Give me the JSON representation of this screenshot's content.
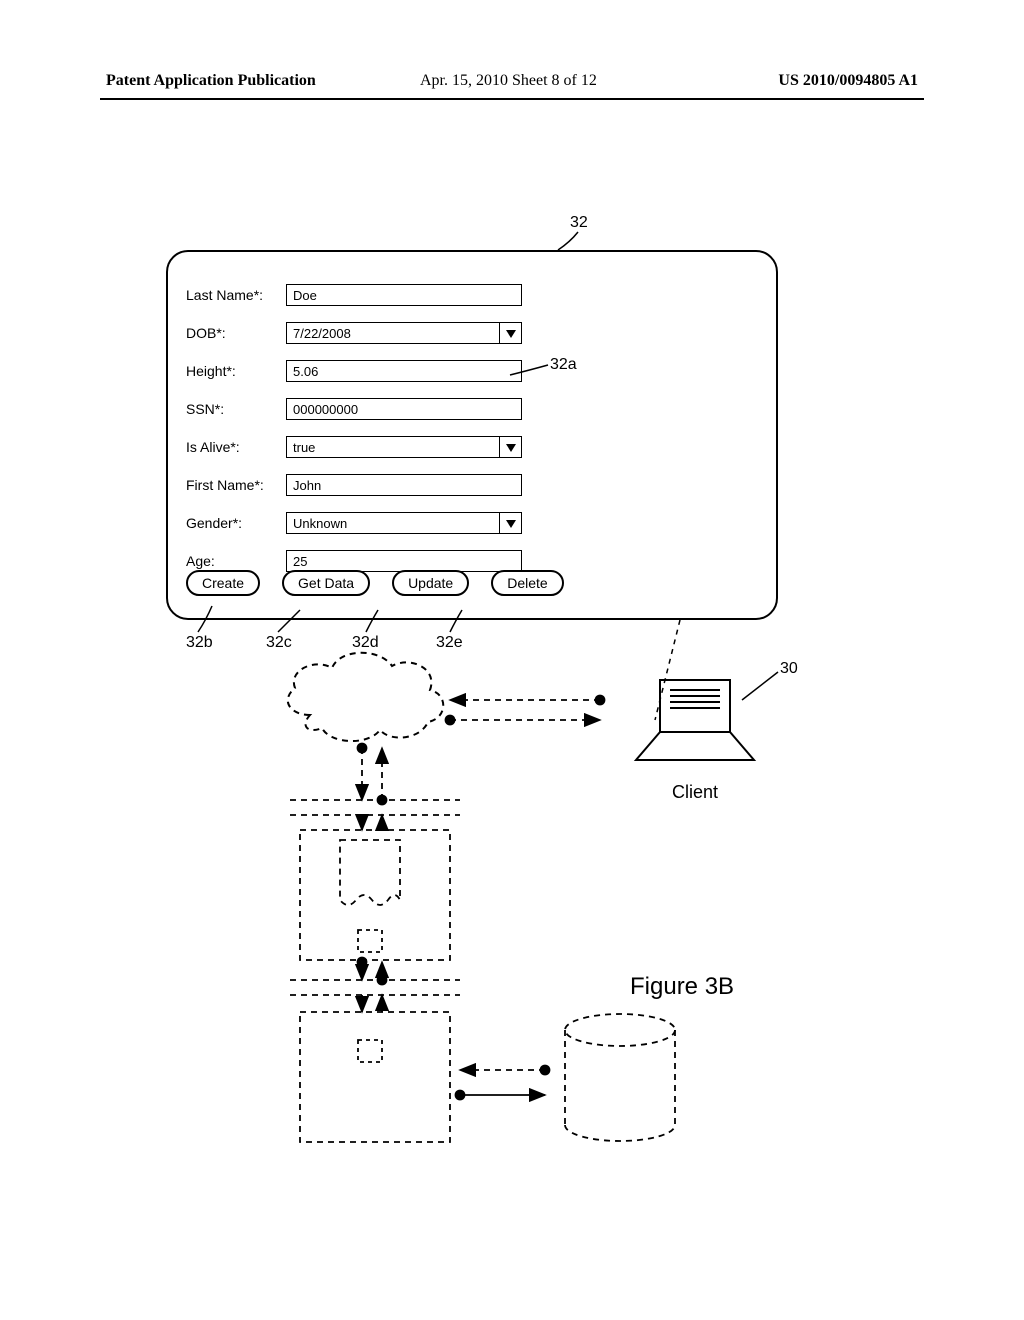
{
  "header": {
    "left": "Patent Application Publication",
    "mid": "Apr. 15, 2010  Sheet 8 of 12",
    "right": "US 2010/0094805 A1"
  },
  "form": {
    "fields": {
      "last_name": {
        "label": "Last Name*:",
        "value": "Doe",
        "dropdown": false
      },
      "dob": {
        "label": "DOB*:",
        "value": "7/22/2008",
        "dropdown": true
      },
      "height": {
        "label": "Height*:",
        "value": "5.06",
        "dropdown": false
      },
      "ssn": {
        "label": "SSN*:",
        "value": "000000000",
        "dropdown": false
      },
      "is_alive": {
        "label": "Is Alive*:",
        "value": "true",
        "dropdown": true
      },
      "first_name": {
        "label": "First Name*:",
        "value": "John",
        "dropdown": false
      },
      "gender": {
        "label": "Gender*:",
        "value": "Unknown",
        "dropdown": true
      },
      "age": {
        "label": "Age:",
        "value": "25",
        "dropdown": false
      }
    },
    "buttons": {
      "create": "Create",
      "get_data": "Get Data",
      "update": "Update",
      "delete": "Delete"
    }
  },
  "refs": {
    "r32": "32",
    "r32a": "32a",
    "r32b": "32b",
    "r32c": "32c",
    "r32d": "32d",
    "r32e": "32e",
    "r30": "30"
  },
  "labels": {
    "client": "Client",
    "figure": "Figure 3B"
  }
}
